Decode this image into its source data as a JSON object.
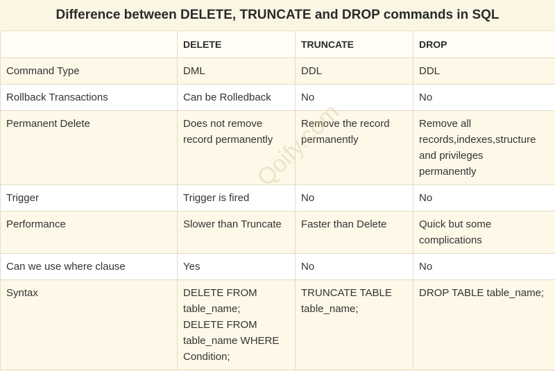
{
  "title": "Difference between DELETE, TRUNCATE and DROP commands in SQL",
  "watermark": "Qoify.com",
  "columns": [
    "",
    "DELETE",
    "TRUNCATE",
    "DROP"
  ],
  "rows": [
    {
      "label": "Command Type",
      "delete": [
        "DML"
      ],
      "truncate": [
        "DDL"
      ],
      "drop": [
        "DDL"
      ]
    },
    {
      "label": "Rollback Transactions",
      "delete": [
        "Can be Rolledback"
      ],
      "truncate": [
        "No"
      ],
      "drop": [
        "No"
      ]
    },
    {
      "label": "Permanent Delete",
      "delete": [
        "Does not remove",
        "record permanently"
      ],
      "truncate": [
        "Remove the record",
        "permanently"
      ],
      "drop": [
        "Remove all",
        "records,indexes,structure",
        "and privileges",
        "permanently"
      ]
    },
    {
      "label": "Trigger",
      "delete": [
        "Trigger is fired"
      ],
      "truncate": [
        "No"
      ],
      "drop": [
        "No"
      ]
    },
    {
      "label": "Performance",
      "delete": [
        "Slower than Truncate"
      ],
      "truncate": [
        "Faster than Delete"
      ],
      "drop": [
        "Quick but some",
        "complications"
      ]
    },
    {
      "label": "Can we use where clause",
      "delete": [
        "Yes"
      ],
      "truncate": [
        "No"
      ],
      "drop": [
        "No"
      ]
    },
    {
      "label": "Syntax",
      "delete": [
        "DELETE FROM",
        "table_name;",
        "DELETE FROM",
        "table_name WHERE",
        "Condition;"
      ],
      "truncate": [
        "TRUNCATE TABLE",
        "table_name;"
      ],
      "drop": [
        "DROP TABLE table_name;"
      ]
    }
  ]
}
